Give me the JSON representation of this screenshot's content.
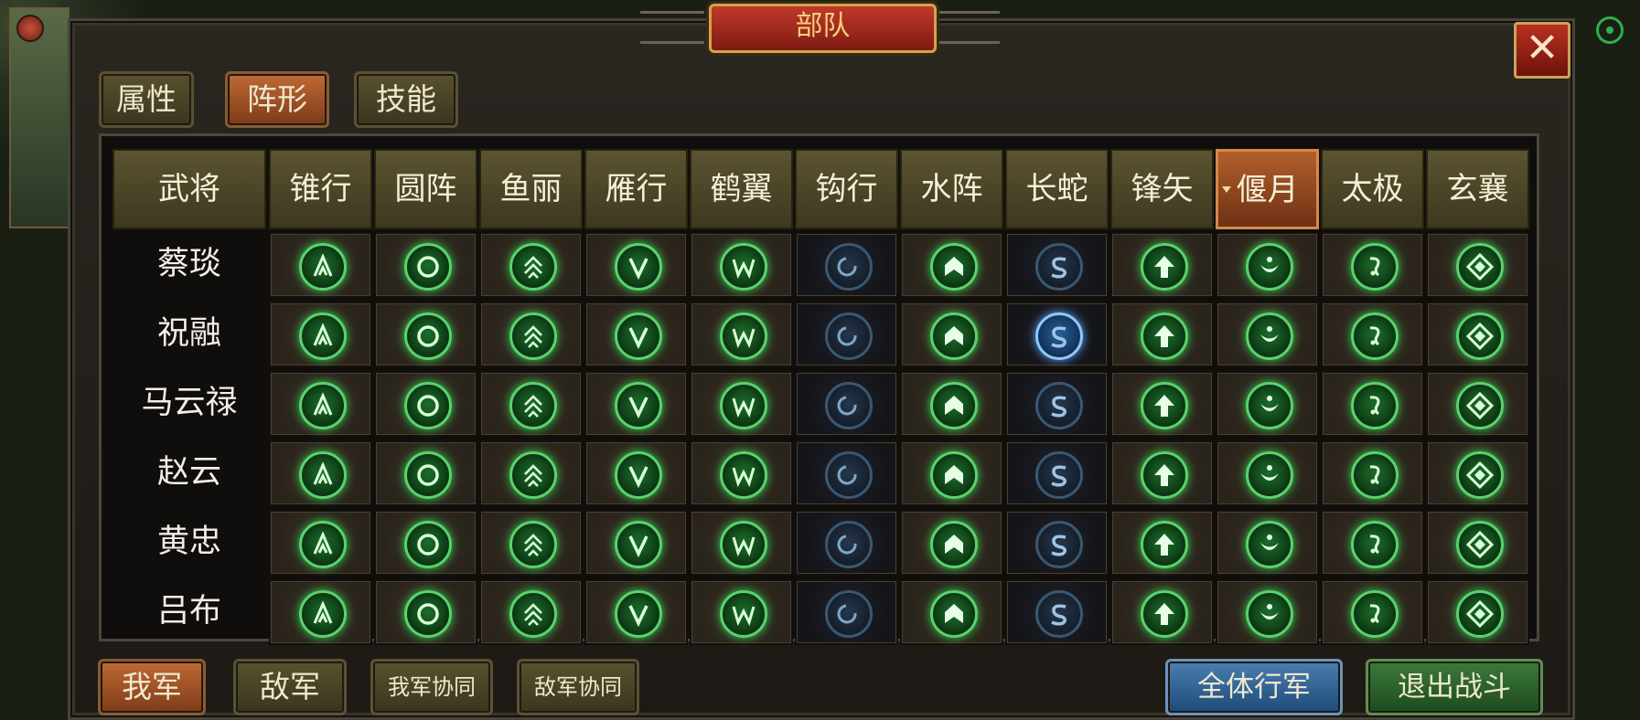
{
  "window": {
    "title": "部队",
    "close_glyph": "✕"
  },
  "tabs": [
    {
      "label": "属性",
      "active": false
    },
    {
      "label": "阵形",
      "active": true
    },
    {
      "label": "技能",
      "active": false
    }
  ],
  "table": {
    "first_header": "武将",
    "formations": [
      "锥行",
      "圆阵",
      "鱼丽",
      "雁行",
      "鹤翼",
      "钩行",
      "水阵",
      "长蛇",
      "锋矢",
      "偃月",
      "太极",
      "玄襄"
    ],
    "selected_formation": "偃月",
    "generals": [
      "蔡琰",
      "祝融",
      "马云禄",
      "赵云",
      "黄忠",
      "吕布"
    ],
    "icon_names": [
      "arrow-chevron-icon",
      "circle-ring-icon",
      "double-chevron-icon",
      "v-icon",
      "w-icon",
      "hook-icon",
      "house-icon",
      "snake-s-icon",
      "up-arrow-icon",
      "crescent-icon",
      "taiji-icon",
      "diamond-icon"
    ],
    "highlight": {
      "general_index": 1,
      "formation": "长蛇"
    }
  },
  "footer": {
    "my_army": "我军",
    "enemy_army": "敌军",
    "my_coop": "我军协同",
    "enemy_coop": "敌军协同",
    "march_all": "全体行军",
    "exit_battle": "退出战斗"
  },
  "colors": {
    "accent_orange": "#c06a35",
    "title_red": "#c0392b",
    "glow_green": "#2fd24d",
    "blue_button": "#4a7fb2",
    "green_button": "#3c7a3a"
  }
}
